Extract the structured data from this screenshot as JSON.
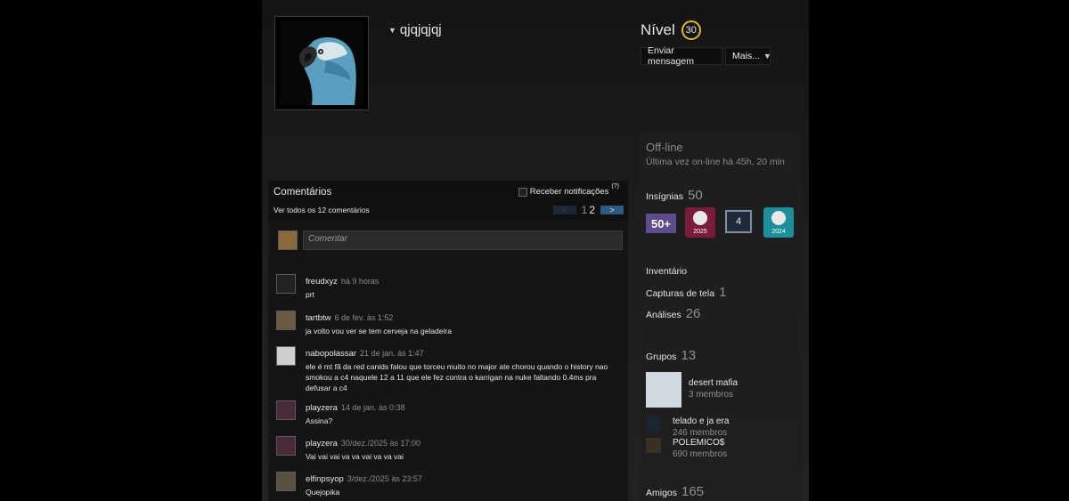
{
  "profile": {
    "persona_name": "qjqjqjqj",
    "level_label": "Nível",
    "level": "30"
  },
  "actions": {
    "message_label": "Enviar mensagem",
    "more_label": "Mais..."
  },
  "status": {
    "state": "Off-line",
    "last_online": "Última vez on-line há 45h, 20 min"
  },
  "sections": {
    "badges": {
      "label": "Insígnias",
      "count": "50",
      "items": [
        {
          "icon": "years-of-service-50-plus",
          "text": "50+"
        },
        {
          "icon": "steam-2025",
          "text": "2025"
        },
        {
          "icon": "level-4-badge",
          "text": "4"
        },
        {
          "icon": "steam-2024",
          "text": "2024"
        }
      ]
    },
    "inventory": {
      "label": "Inventário"
    },
    "screenshots": {
      "label": "Capturas de tela",
      "count": "1"
    },
    "reviews": {
      "label": "Análises",
      "count": "26"
    },
    "groups": {
      "label": "Grupos",
      "count": "13",
      "items": [
        {
          "name": "desert mafia",
          "members": "3 membros"
        },
        {
          "name": "telado e ja era",
          "members": "246 membros"
        },
        {
          "name": "POLEMICO$",
          "members": "690 membros"
        }
      ]
    },
    "friends": {
      "label": "Amigos",
      "count": "165"
    }
  },
  "comments": {
    "title": "Comentários",
    "view_all": "Ver todos os 12 comentários",
    "notify_label": "Receber notificações",
    "help": "(?)",
    "pages": [
      "1",
      "2"
    ],
    "prev": "<",
    "next": ">",
    "placeholder": "Comentar",
    "items": [
      {
        "author": "freudxyz",
        "time": "há 9 horas",
        "text": "prt"
      },
      {
        "author": "tartbtw",
        "time": "6 de fev. às 1:52",
        "text": "ja volto vou ver se tem cerveja na geladeira"
      },
      {
        "author": "nabopolassar",
        "time": "21 de jan. às 1:47",
        "text": "ele é mt fã da red canids falou que torceu muito no major ate chorou quando o history nao smokou a c4 naquele 12 a 11 que ele fez contra o karrigan na nuke faltando 0.4ms pra defusar a c4"
      },
      {
        "author": "playzera",
        "time": "14 de jan. às 0:38",
        "text": "Assina?"
      },
      {
        "author": "playzera",
        "time": "30/dez./2025 às 17:00",
        "text": "Vai vai vai va va vai va va vai"
      },
      {
        "author": "elfinpsyop",
        "time": "3/dez./2025 às 23:57",
        "text": "Quejopika"
      }
    ]
  }
}
